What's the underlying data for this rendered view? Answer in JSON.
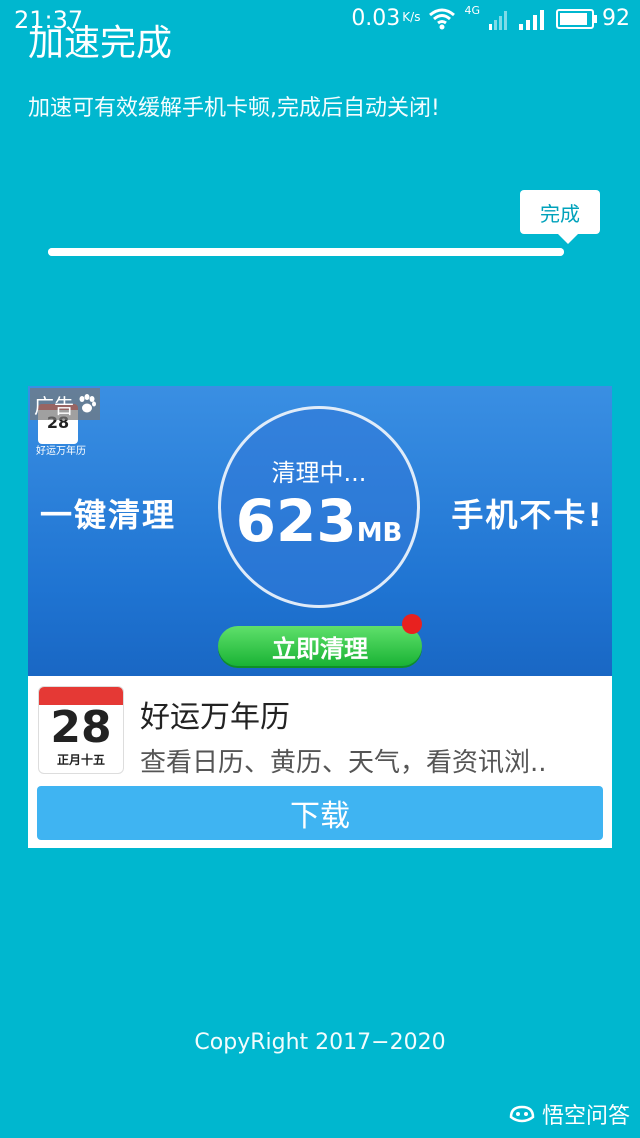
{
  "status_bar": {
    "time": "21:37",
    "net_speed": "0.03",
    "net_unit": "K/s",
    "network_type": "4G",
    "battery": "92",
    "battery_fraction": 0.92
  },
  "header": {
    "title": "加速完成",
    "subtitle": "加速可有效缓解手机卡顿,完成后自动关闭!"
  },
  "progress": {
    "fraction": 1.0,
    "tooltip": "完成"
  },
  "ad": {
    "label": "广告",
    "banner": {
      "mini_calendar_day": "28",
      "mini_calendar_name": "好运万年历",
      "left_slogan": "一键清理",
      "right_slogan": "手机不卡!",
      "circle_status": "清理中...",
      "circle_value": "623",
      "circle_unit": "MB",
      "button_label": "立即清理"
    },
    "app": {
      "icon_day": "28",
      "icon_lunar": "正月十五",
      "name": "好运万年历",
      "description": "查看日历、黄历、天气，看资讯浏.."
    },
    "download_label": "下载"
  },
  "footer": {
    "copyright": "CopyRight 2017−2020",
    "watermark": "悟空问答"
  }
}
